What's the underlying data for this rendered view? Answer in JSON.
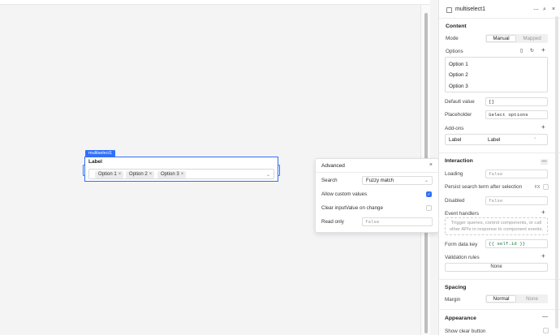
{
  "canvas": {
    "component_tag": "multiselect1",
    "component_label": "Label",
    "chips": [
      {
        "label": "Option 1"
      },
      {
        "label": "Option 2"
      },
      {
        "label": "Option 3"
      }
    ],
    "chip_remove": "×",
    "chevron": "⌄"
  },
  "advanced": {
    "title": "Advanced",
    "close": "×",
    "search_label": "Search",
    "search_value": "Fuzzy match",
    "allow_custom_label": "Allow custom values",
    "allow_custom_checked": true,
    "clear_input_label": "Clear inputValue on change",
    "clear_input_checked": false,
    "read_only_label": "Read only",
    "read_only_value": "false"
  },
  "panel": {
    "title": "multiselect1",
    "content_section": "Content",
    "mode_label": "Mode",
    "mode_manual": "Manual",
    "mode_mapped": "Mapped",
    "options_label": "Options",
    "options": [
      "Option 1",
      "Option 2",
      "Option 3"
    ],
    "default_value_label": "Default value",
    "default_value": "[]",
    "placeholder_label": "Placeholder",
    "placeholder_value": "Select options",
    "addons_label": "Add-ons",
    "addon_label_name": "Label",
    "addon_label_value": "Label",
    "interaction_section": "Interaction",
    "loading_label": "Loading",
    "loading_value": "false",
    "persist_label": "Persist search term after selection",
    "persist_fx": "FX",
    "disabled_label": "Disabled",
    "disabled_value": "false",
    "event_handlers_label": "Event handlers",
    "event_handlers_hint": "Trigger queries, control components, or call other APIs in response to component events.",
    "form_data_key_label": "Form data key",
    "form_data_key_value": "{{ self.id }}",
    "validation_label": "Validation rules",
    "validation_value": "None",
    "spacing_section": "Spacing",
    "margin_label": "Margin",
    "margin_normal": "Normal",
    "margin_none": "None",
    "appearance_section": "Appearance",
    "show_clear_label": "Show clear button"
  },
  "colors": {
    "accent": "#3170f9",
    "code_green": "#1a7f3c"
  }
}
